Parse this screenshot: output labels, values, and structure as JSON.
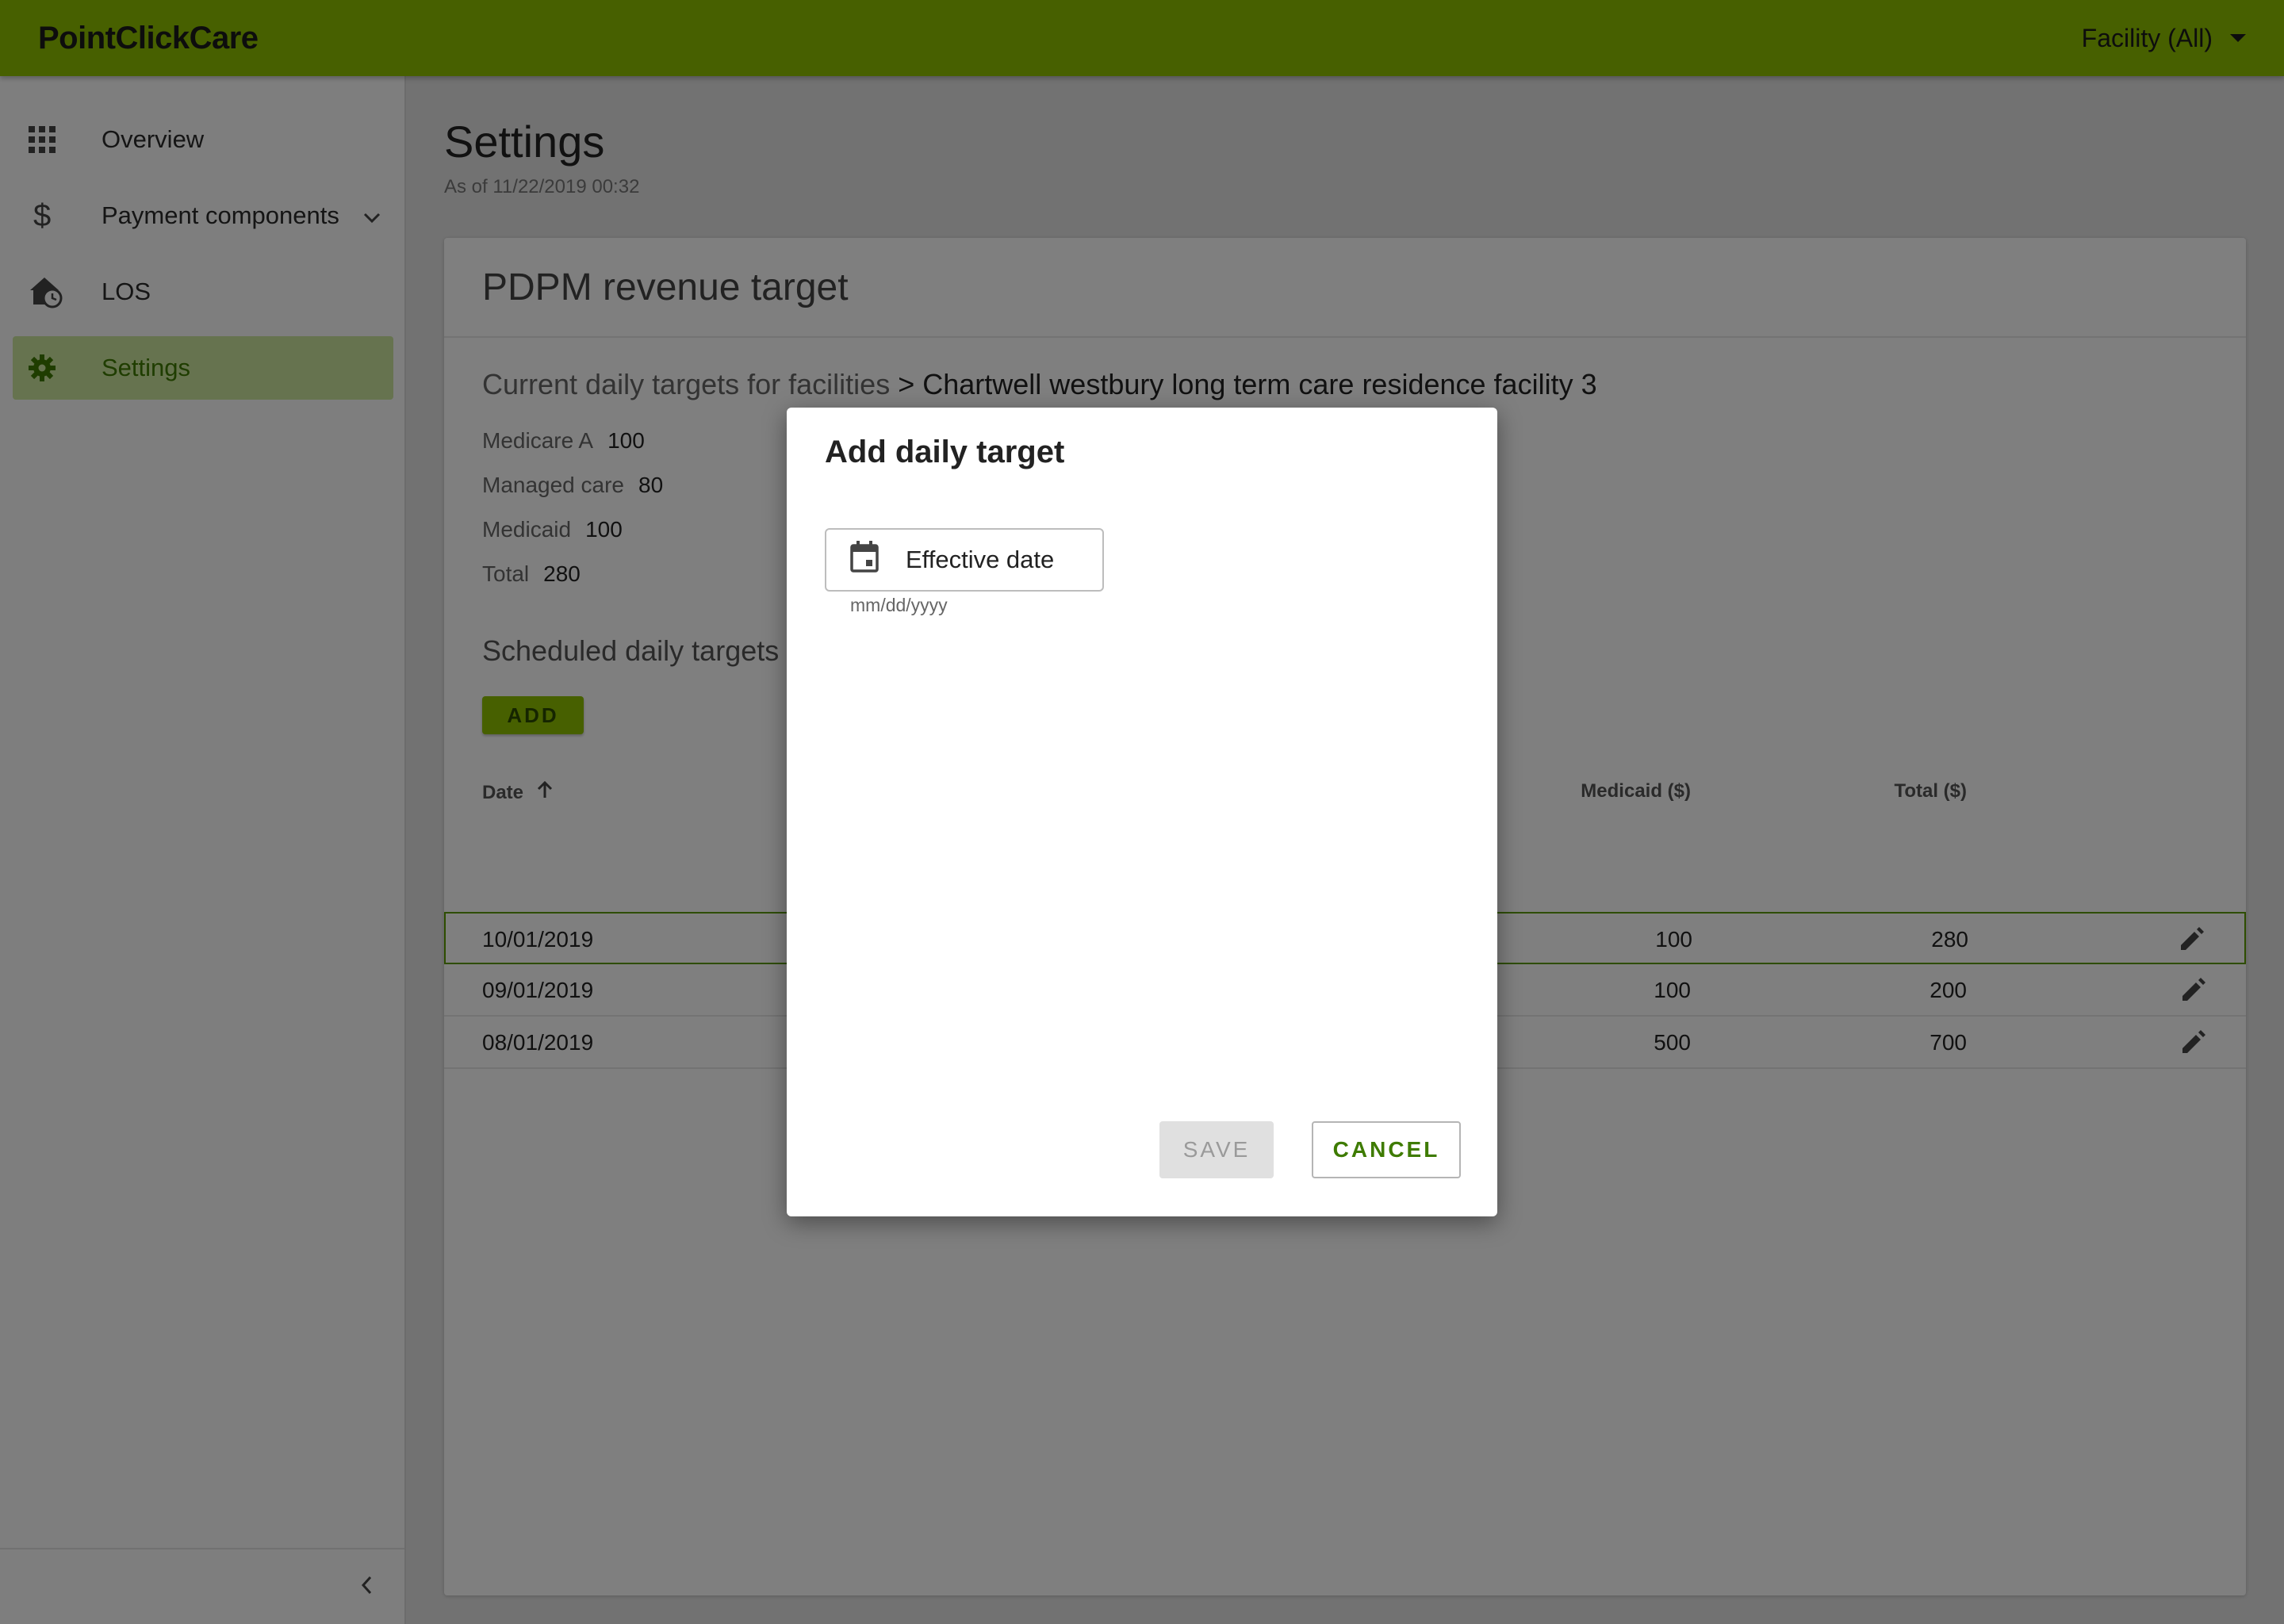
{
  "app": {
    "brand": "PointClickCare",
    "facility_selector": "Facility (All)"
  },
  "sidebar": {
    "items": [
      {
        "label": "Overview",
        "icon": "grid-icon"
      },
      {
        "label": "Payment components",
        "icon": "dollar-icon"
      },
      {
        "label": "LOS",
        "icon": "house-clock-icon"
      },
      {
        "label": "Settings",
        "icon": "gear-icon",
        "active": true
      }
    ]
  },
  "page": {
    "title": "Settings",
    "as_of": "As of 11/22/2019 00:32"
  },
  "card": {
    "title": "PDPM revenue target",
    "current_prefix": "Current daily targets for facilities",
    "current_facility": "> Chartwell westbury long term care residence facility 3",
    "current_targets": [
      {
        "label": "Medicare A",
        "value": "100"
      },
      {
        "label": "Managed care",
        "value": "80"
      },
      {
        "label": "Medicaid",
        "value": "100"
      },
      {
        "label": "Total",
        "value": "280"
      }
    ],
    "scheduled_title": "Scheduled daily targets",
    "add_label": "ADD",
    "table": {
      "headers": {
        "date": "Date",
        "medicaid": "Medicaid ($)",
        "total": "Total ($)"
      },
      "rows": [
        {
          "date": "10/01/2019",
          "medicaid": "100",
          "total": "280"
        },
        {
          "date": "09/01/2019",
          "medicaid": "100",
          "total": "200"
        },
        {
          "date": "08/01/2019",
          "medicaid": "500",
          "total": "700"
        }
      ]
    }
  },
  "dialog": {
    "title": "Add daily target",
    "date_button": "Effective date",
    "date_hint": "mm/dd/yyyy",
    "save": "SAVE",
    "cancel": "CANCEL"
  },
  "colors": {
    "brand": "#8ec100",
    "accent": "#3e7b00",
    "active_bg": "#cde69e"
  }
}
